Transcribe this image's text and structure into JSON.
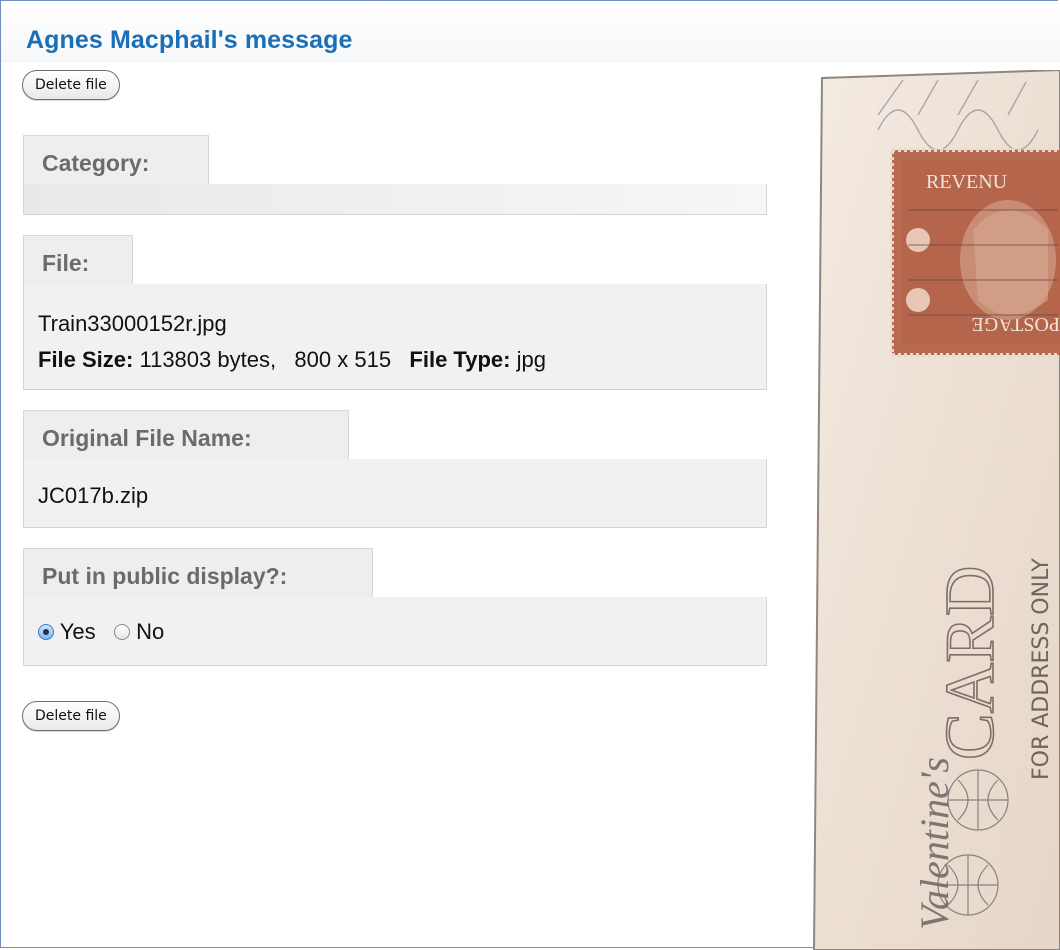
{
  "page": {
    "title": "Agnes Macphail's message",
    "delete_button_top": "Delete file",
    "delete_button_bottom": "Delete file"
  },
  "fields": {
    "category": {
      "label": "Category:",
      "value": ""
    },
    "file": {
      "label": "File:",
      "filename": "Train33000152r.jpg",
      "size_label": "File Size:",
      "size_value": "113803 bytes,",
      "dimensions": "800 x 515",
      "type_label": "File Type:",
      "type_value": "jpg"
    },
    "original_name": {
      "label": "Original File Name:",
      "value": "JC017b.zip"
    },
    "public_display": {
      "label": "Put in public display?:",
      "options": [
        "Yes",
        "No"
      ],
      "selected": "Yes"
    }
  },
  "postcard": {
    "stamp_top": "REVENU",
    "stamp_bottom": "POSTAGE",
    "postmark_word": "CARD",
    "address_text": "FOR ADDRESS ONLY",
    "signature": "Valentine's"
  },
  "colors": {
    "title": "#1a6fb8",
    "stamp": "#b76a4f",
    "card": "#efe3d8"
  }
}
